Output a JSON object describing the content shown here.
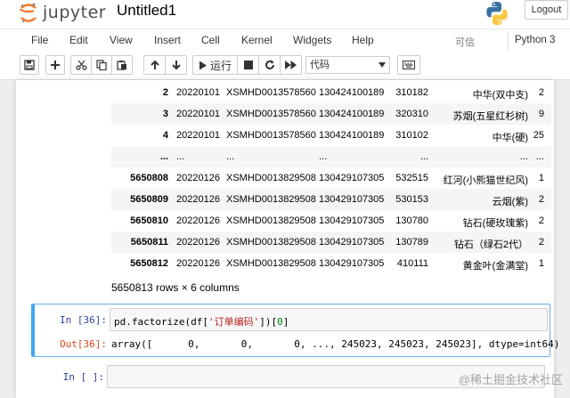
{
  "header": {
    "logo_text": "jupyter",
    "notebook_title": "Untitled1",
    "logout_label": "Logout"
  },
  "menubar": {
    "items": [
      "File",
      "Edit",
      "View",
      "Insert",
      "Cell",
      "Kernel",
      "Widgets",
      "Help"
    ],
    "trusted_label": "可信",
    "kernel_name": "Python 3"
  },
  "toolbar": {
    "run_label": "运行",
    "cell_type": "代码"
  },
  "dataframe": {
    "rows": [
      {
        "index": "2",
        "c1": "20220101",
        "c2": "XSMHD0013578560",
        "c3": "130424100189",
        "c4": "310182",
        "c5": "中华(双中支)",
        "c6": "2"
      },
      {
        "index": "3",
        "c1": "20220101",
        "c2": "XSMHD0013578560",
        "c3": "130424100189",
        "c4": "320310",
        "c5": "苏烟(五星红杉树)",
        "c6": "9"
      },
      {
        "index": "4",
        "c1": "20220101",
        "c2": "XSMHD0013578560",
        "c3": "130424100189",
        "c4": "310102",
        "c5": "中华(硬)",
        "c6": "25"
      },
      {
        "index": "...",
        "c1": "...",
        "c2": "...",
        "c3": "...",
        "c4": "...",
        "c5": "...",
        "c6": "..."
      },
      {
        "index": "5650808",
        "c1": "20220126",
        "c2": "XSMHD0013829508",
        "c3": "130429107305",
        "c4": "532515",
        "c5": "红河(小熊猫世纪风)",
        "c6": "1"
      },
      {
        "index": "5650809",
        "c1": "20220126",
        "c2": "XSMHD0013829508",
        "c3": "130429107305",
        "c4": "530153",
        "c5": "云烟(紫)",
        "c6": "2"
      },
      {
        "index": "5650810",
        "c1": "20220126",
        "c2": "XSMHD0013829508",
        "c3": "130429107305",
        "c4": "130780",
        "c5": "钻石(硬玫瑰紫)",
        "c6": "2"
      },
      {
        "index": "5650811",
        "c1": "20220126",
        "c2": "XSMHD0013829508",
        "c3": "130429107305",
        "c4": "130789",
        "c5": "钻石（绿石2代）",
        "c6": "2"
      },
      {
        "index": "5650812",
        "c1": "20220126",
        "c2": "XSMHD0013829508",
        "c3": "130429107305",
        "c4": "410111",
        "c5": "黄金叶(金满堂)",
        "c6": "1"
      }
    ],
    "shape_text": "5650813 rows × 6 columns"
  },
  "cells": {
    "cell36": {
      "in_prompt": "In  [36]:",
      "code_prefix": "pd.factorize(df[",
      "code_string": "'订单编码'",
      "code_mid": "])[",
      "code_index": "0",
      "code_suffix": "]",
      "out_prompt": "Out[36]:",
      "output": "array([      0,       0,       0, ..., 245023, 245023, 245023], dtype=int64)"
    },
    "empty": {
      "in_prompt": "In  [ ]:"
    }
  },
  "watermark": "@稀土掘金技术社区"
}
